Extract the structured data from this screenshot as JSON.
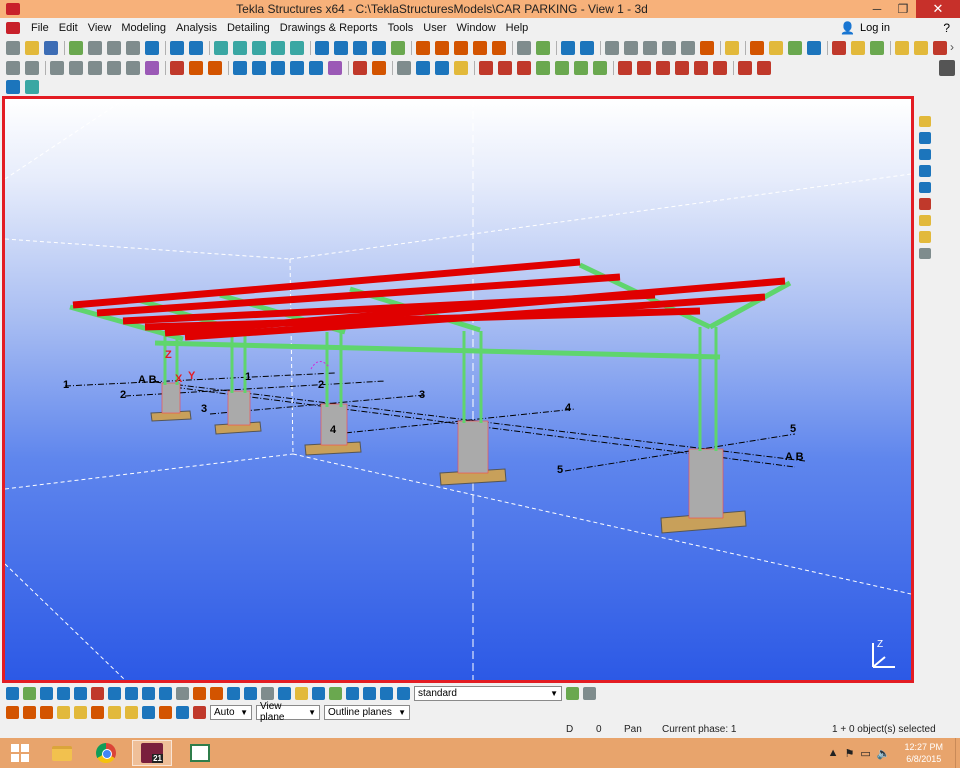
{
  "window": {
    "title": "Tekla Structures x64 - C:\\TeklaStructuresModels\\CAR PARKING  - View 1 - 3d",
    "minimize": "─",
    "restore": "❐",
    "close": "✕"
  },
  "menu": {
    "items": [
      "File",
      "Edit",
      "View",
      "Modeling",
      "Analysis",
      "Detailing",
      "Drawings & Reports",
      "Tools",
      "User",
      "Window",
      "Help"
    ],
    "login_label": "Log in",
    "help_glyph": "?",
    "arrow_glyph": "›"
  },
  "viewport": {
    "grid_numbers": [
      "1",
      "2",
      "3",
      "4",
      "5"
    ],
    "grid_letters": "A B",
    "axis_labels": {
      "z": "Z",
      "x": "X",
      "y": "Y"
    },
    "frame_color": "#e31c23",
    "beam_color": "#e00000",
    "steel_color": "#66dd77"
  },
  "bottom_toolbar": {
    "filter_value": "standard",
    "work_area_value": "Auto",
    "view_plane_value": "View plane",
    "outline_value": "Outline planes"
  },
  "status": {
    "d_label": "D",
    "zero": "0",
    "mode": "Pan",
    "phase": "Current phase: 1",
    "selection": "1 + 0 object(s) selected"
  },
  "taskbar": {
    "tekla_badge": "21",
    "time": "12:27 PM",
    "date": "6/8/2015",
    "tray_arrow": "▲",
    "tray_flag": "⚑",
    "tray_battery": "▭",
    "tray_volume": "🔈"
  }
}
